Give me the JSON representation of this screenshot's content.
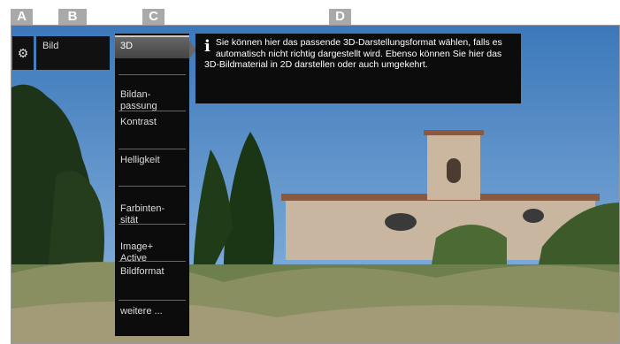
{
  "labels": {
    "a": "A",
    "b": "B",
    "c": "C",
    "d": "D"
  },
  "settings": {
    "icon": "gear-icon"
  },
  "category": {
    "label": "Bild"
  },
  "menu": {
    "items": [
      {
        "label": "3D",
        "selected": true
      },
      {
        "label": "Bildan-\npassung"
      },
      {
        "label": "Kontrast"
      },
      {
        "label": "Helligkeit"
      },
      {
        "label": "Farbinten-\nsität"
      },
      {
        "label": "Image+\nActive"
      },
      {
        "label": "Bildformat"
      },
      {
        "label": "weitere ..."
      }
    ]
  },
  "info": {
    "icon": "info-icon",
    "text": "Sie können hier das passende 3D-Darstellungsformat wählen, falls es automatisch nicht richtig dargestellt wird. Ebenso können Sie hier das 3D-Bildmaterial in 2D darstellen oder auch umgekehrt."
  },
  "colors": {
    "menu_bg": "#0c0c0c",
    "sky": "#4a86c4",
    "badge": "#a9a9a9"
  }
}
